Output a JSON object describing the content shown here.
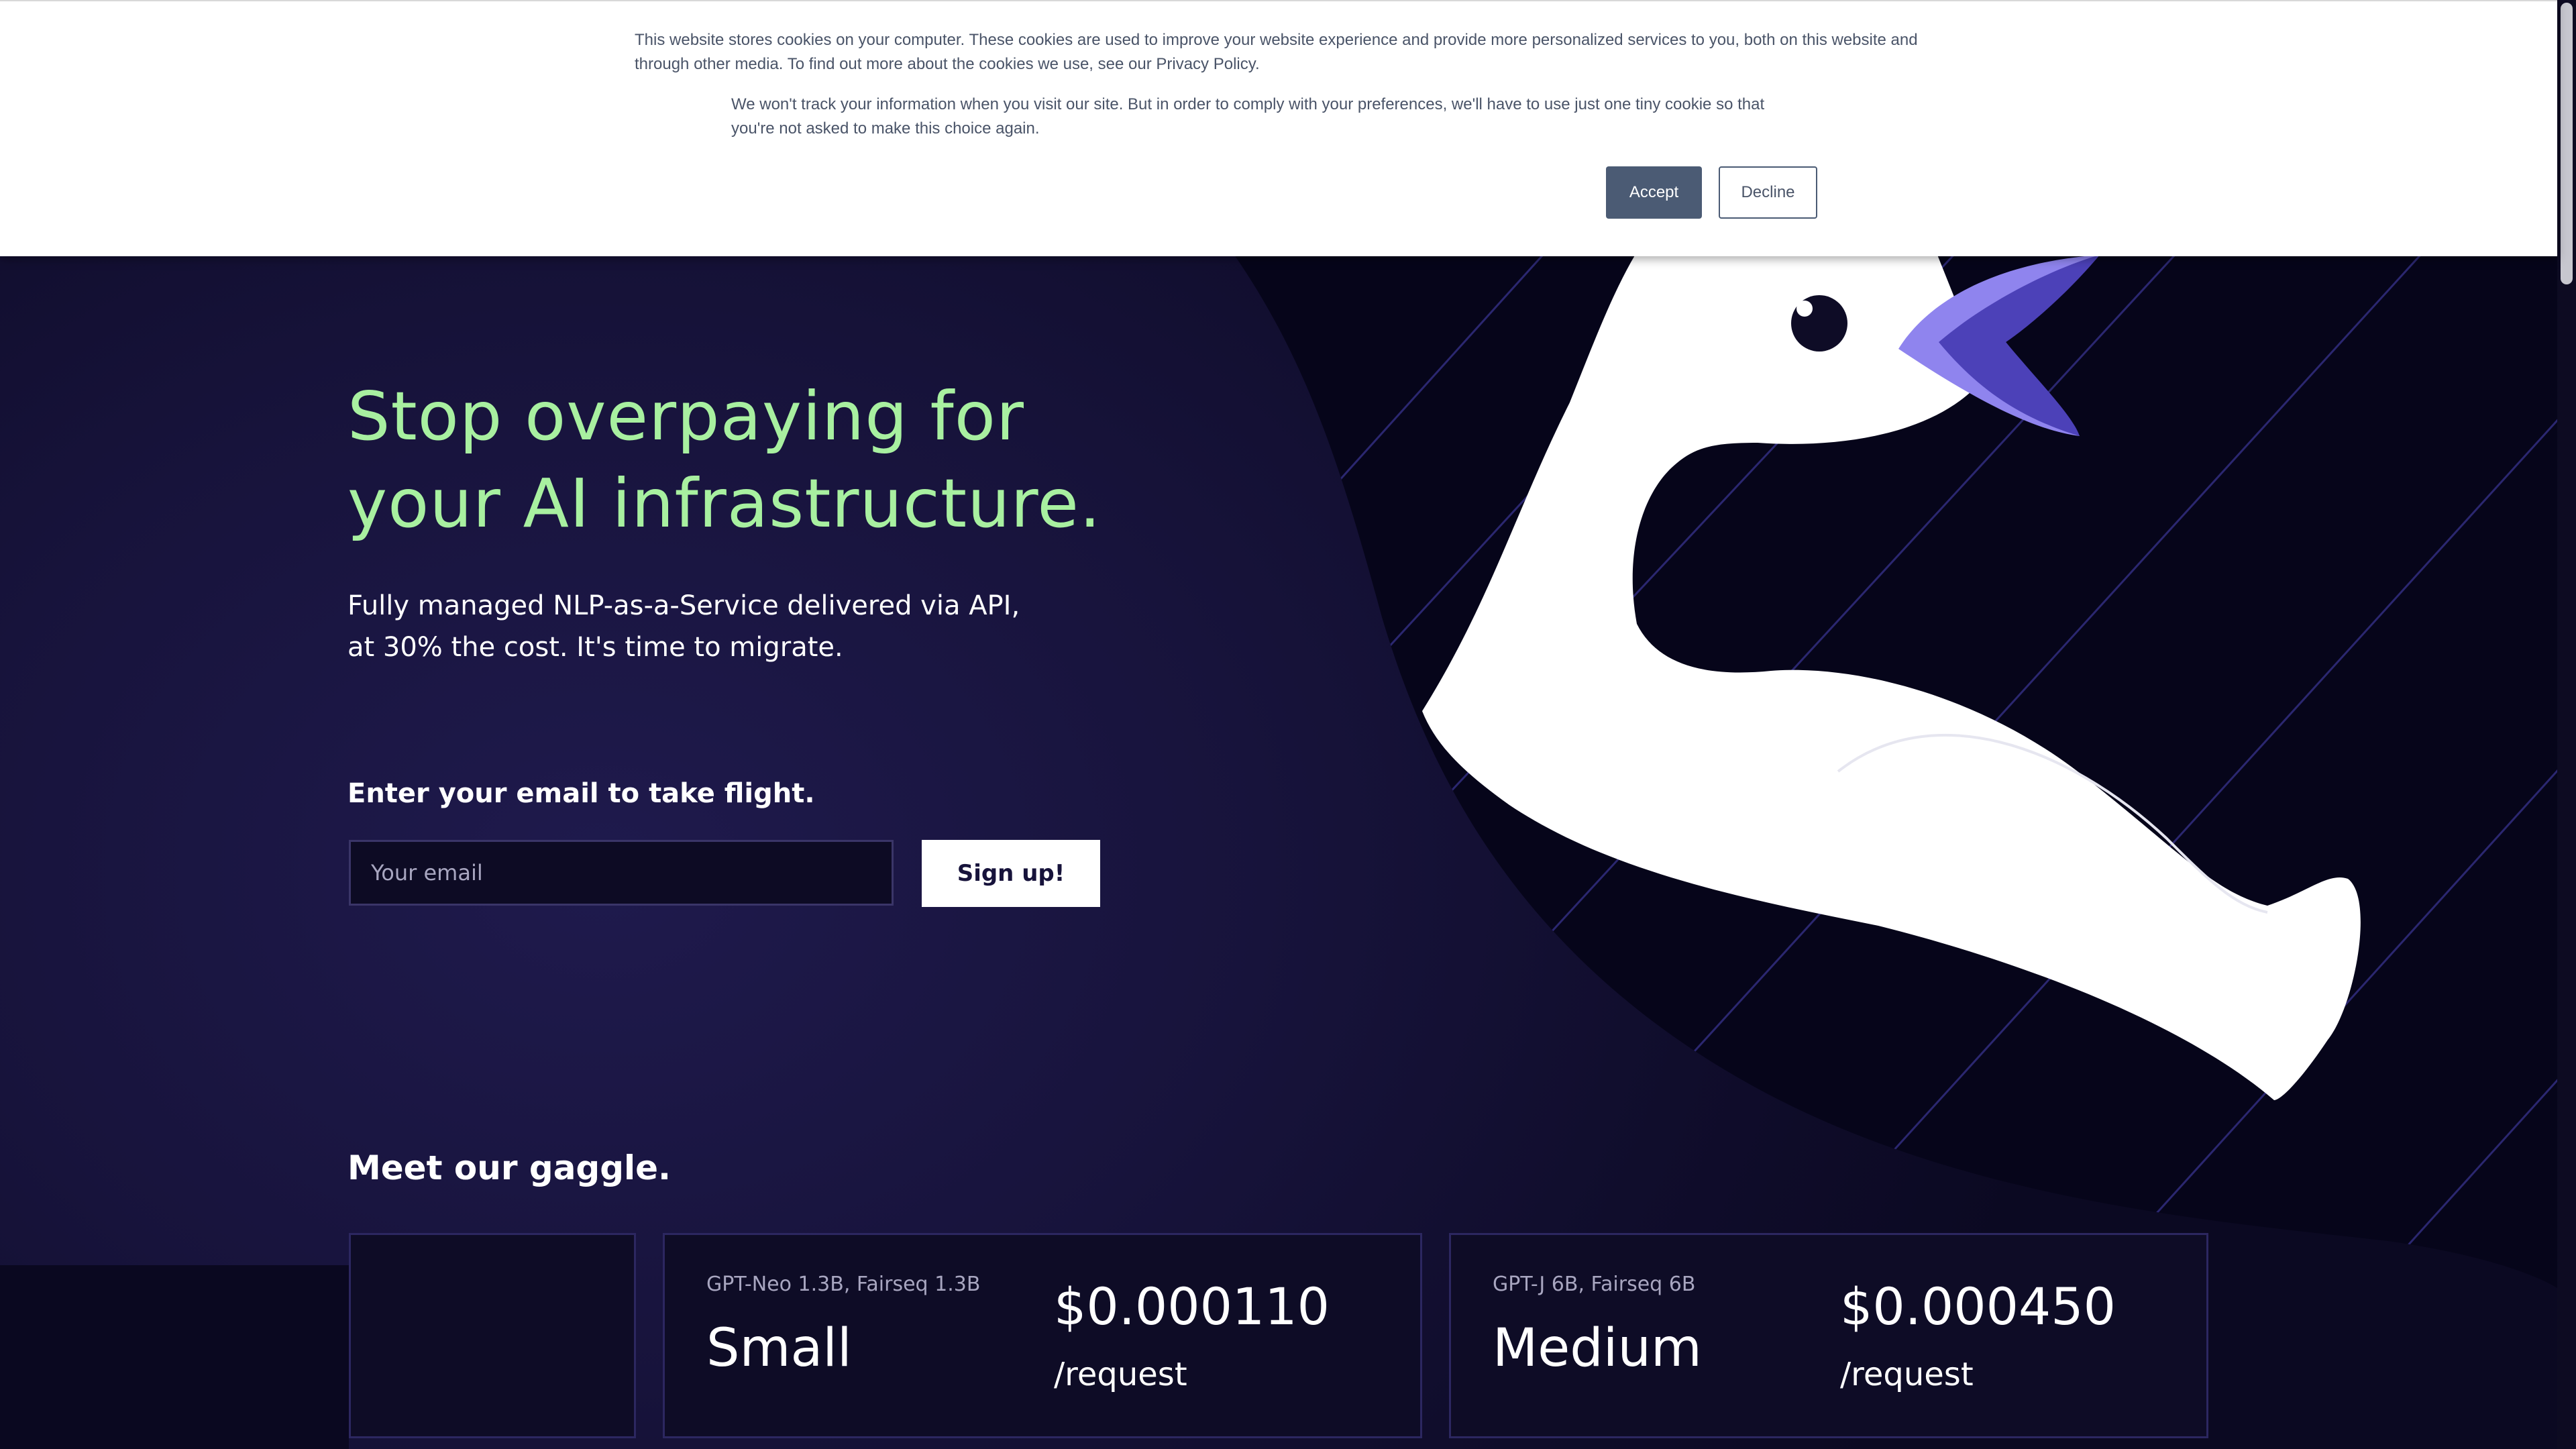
{
  "colors": {
    "background": "#17133b",
    "headline": "#a8f0a0",
    "accent_purple": "#6e62e0",
    "accept_button": "#4b5b74"
  },
  "cookie_banner": {
    "text_primary": "This website stores cookies on your computer. These cookies are used to improve your website experience and provide more personalized services to you, both on this website and through other media. To find out more about the cookies we use, see our Privacy Policy.",
    "text_secondary": "We won't track your information when you visit our site. But in order to comply with your preferences, we'll have to use just one tiny cookie so that you're not asked to make this choice again.",
    "accept_label": "Accept",
    "decline_label": "Decline"
  },
  "hero": {
    "headline_line1": "Stop overpaying for",
    "headline_line2": "your AI infrastructure.",
    "subhead_line1": "Fully managed NLP-as-a-Service delivered via API,",
    "subhead_line2": "at 30% the cost. It's time to migrate.",
    "illustration": "goose-illustration"
  },
  "signup": {
    "label": "Enter your email to take flight.",
    "email_placeholder": "Your email",
    "email_value": "",
    "button_label": "Sign up!"
  },
  "gaggle": {
    "title": "Meet our gaggle.",
    "tiers": [
      {
        "models": "GPT-Neo 1.3B, Fairseq 1.3B",
        "name": "Small",
        "price": "$0.000110",
        "unit": "/request"
      },
      {
        "models": "GPT-J 6B, Fairseq 6B",
        "name": "Medium",
        "price": "$0.000450",
        "unit": "/request"
      }
    ]
  }
}
